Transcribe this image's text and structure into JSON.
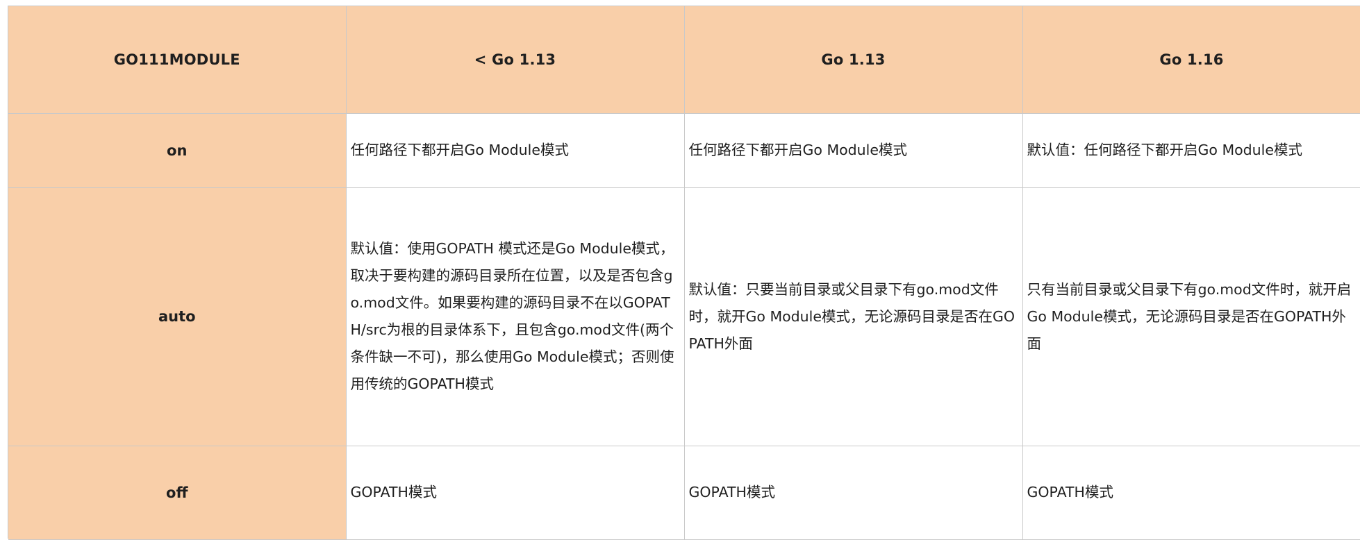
{
  "table": {
    "headers": [
      "GO111MODULE",
      "< Go 1.13",
      "Go 1.13",
      "Go 1.16"
    ],
    "rows": [
      {
        "key": "on",
        "cells": [
          "任何路径下都开启Go Module模式",
          "任何路径下都开启Go Module模式",
          "默认值：任何路径下都开启Go Module模式"
        ]
      },
      {
        "key": "auto",
        "cells": [
          "默认值：使用GOPATH 模式还是Go Module模式，取决于要构建的源码目录所在位置，以及是否包含go.mod文件。如果要构建的源码目录不在以GOPATH/src为根的目录体系下，且包含go.mod文件(两个条件缺一不可)，那么使用Go Module模式；否则使用传统的GOPATH模式",
          "默认值：只要当前目录或父目录下有go.mod文件时，就开Go Module模式，无论源码目录是否在GOPATH外面",
          "只有当前目录或父目录下有go.mod文件时，就开启Go Module模式，无论源码目录是否在GOPATH外面"
        ]
      },
      {
        "key": "off",
        "cells": [
          "GOPATH模式",
          "GOPATH模式",
          "GOPATH模式"
        ]
      }
    ]
  },
  "colors": {
    "header_bg": "#f9cfa9",
    "border": "#c9c9c9",
    "cell_bg": "#ffffff"
  }
}
